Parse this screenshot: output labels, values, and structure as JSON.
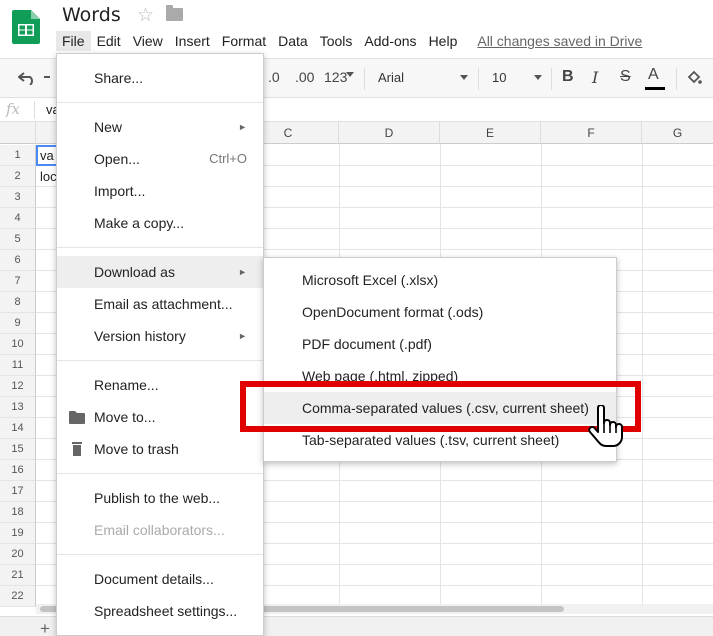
{
  "doc": {
    "title": "Words",
    "saved_status": "All changes saved in Drive"
  },
  "menubar": [
    "File",
    "Edit",
    "View",
    "Insert",
    "Format",
    "Data",
    "Tools",
    "Add-ons",
    "Help"
  ],
  "toolbar": {
    "decimal_less": ".0",
    "decimal_more": ".00",
    "number_format": "123",
    "font": "Arial",
    "size": "10"
  },
  "formula_bar": {
    "fx": "fx",
    "value": "va"
  },
  "columns": [
    "C",
    "D",
    "E",
    "F",
    "G"
  ],
  "rows": [
    "1",
    "2",
    "3",
    "4",
    "5",
    "6",
    "7",
    "8",
    "9",
    "10",
    "11",
    "12",
    "13",
    "14",
    "15",
    "16",
    "17",
    "18",
    "19",
    "20",
    "21",
    "22"
  ],
  "cells": {
    "a1": "va",
    "a2": "loc"
  },
  "file_menu": {
    "share": "Share...",
    "new": "New",
    "open": "Open...",
    "open_shortcut": "Ctrl+O",
    "import": "Import...",
    "make_copy": "Make a copy...",
    "download_as": "Download as",
    "email_attachment": "Email as attachment...",
    "version_history": "Version history",
    "rename": "Rename...",
    "move_to": "Move to...",
    "move_trash": "Move to trash",
    "publish": "Publish to the web...",
    "email_collab": "Email collaborators...",
    "doc_details": "Document details...",
    "sheet_settings": "Spreadsheet settings..."
  },
  "download_menu": {
    "xlsx": "Microsoft Excel (.xlsx)",
    "ods": "OpenDocument format (.ods)",
    "pdf": "PDF document (.pdf)",
    "html": "Web page (.html, zipped)",
    "csv": "Comma-separated values (.csv, current sheet)",
    "tsv": "Tab-separated values (.tsv, current sheet)"
  },
  "colors": {
    "sheets_green": "#0f9d58",
    "highlight_red": "#e00000",
    "selection_blue": "#4a8af4"
  }
}
